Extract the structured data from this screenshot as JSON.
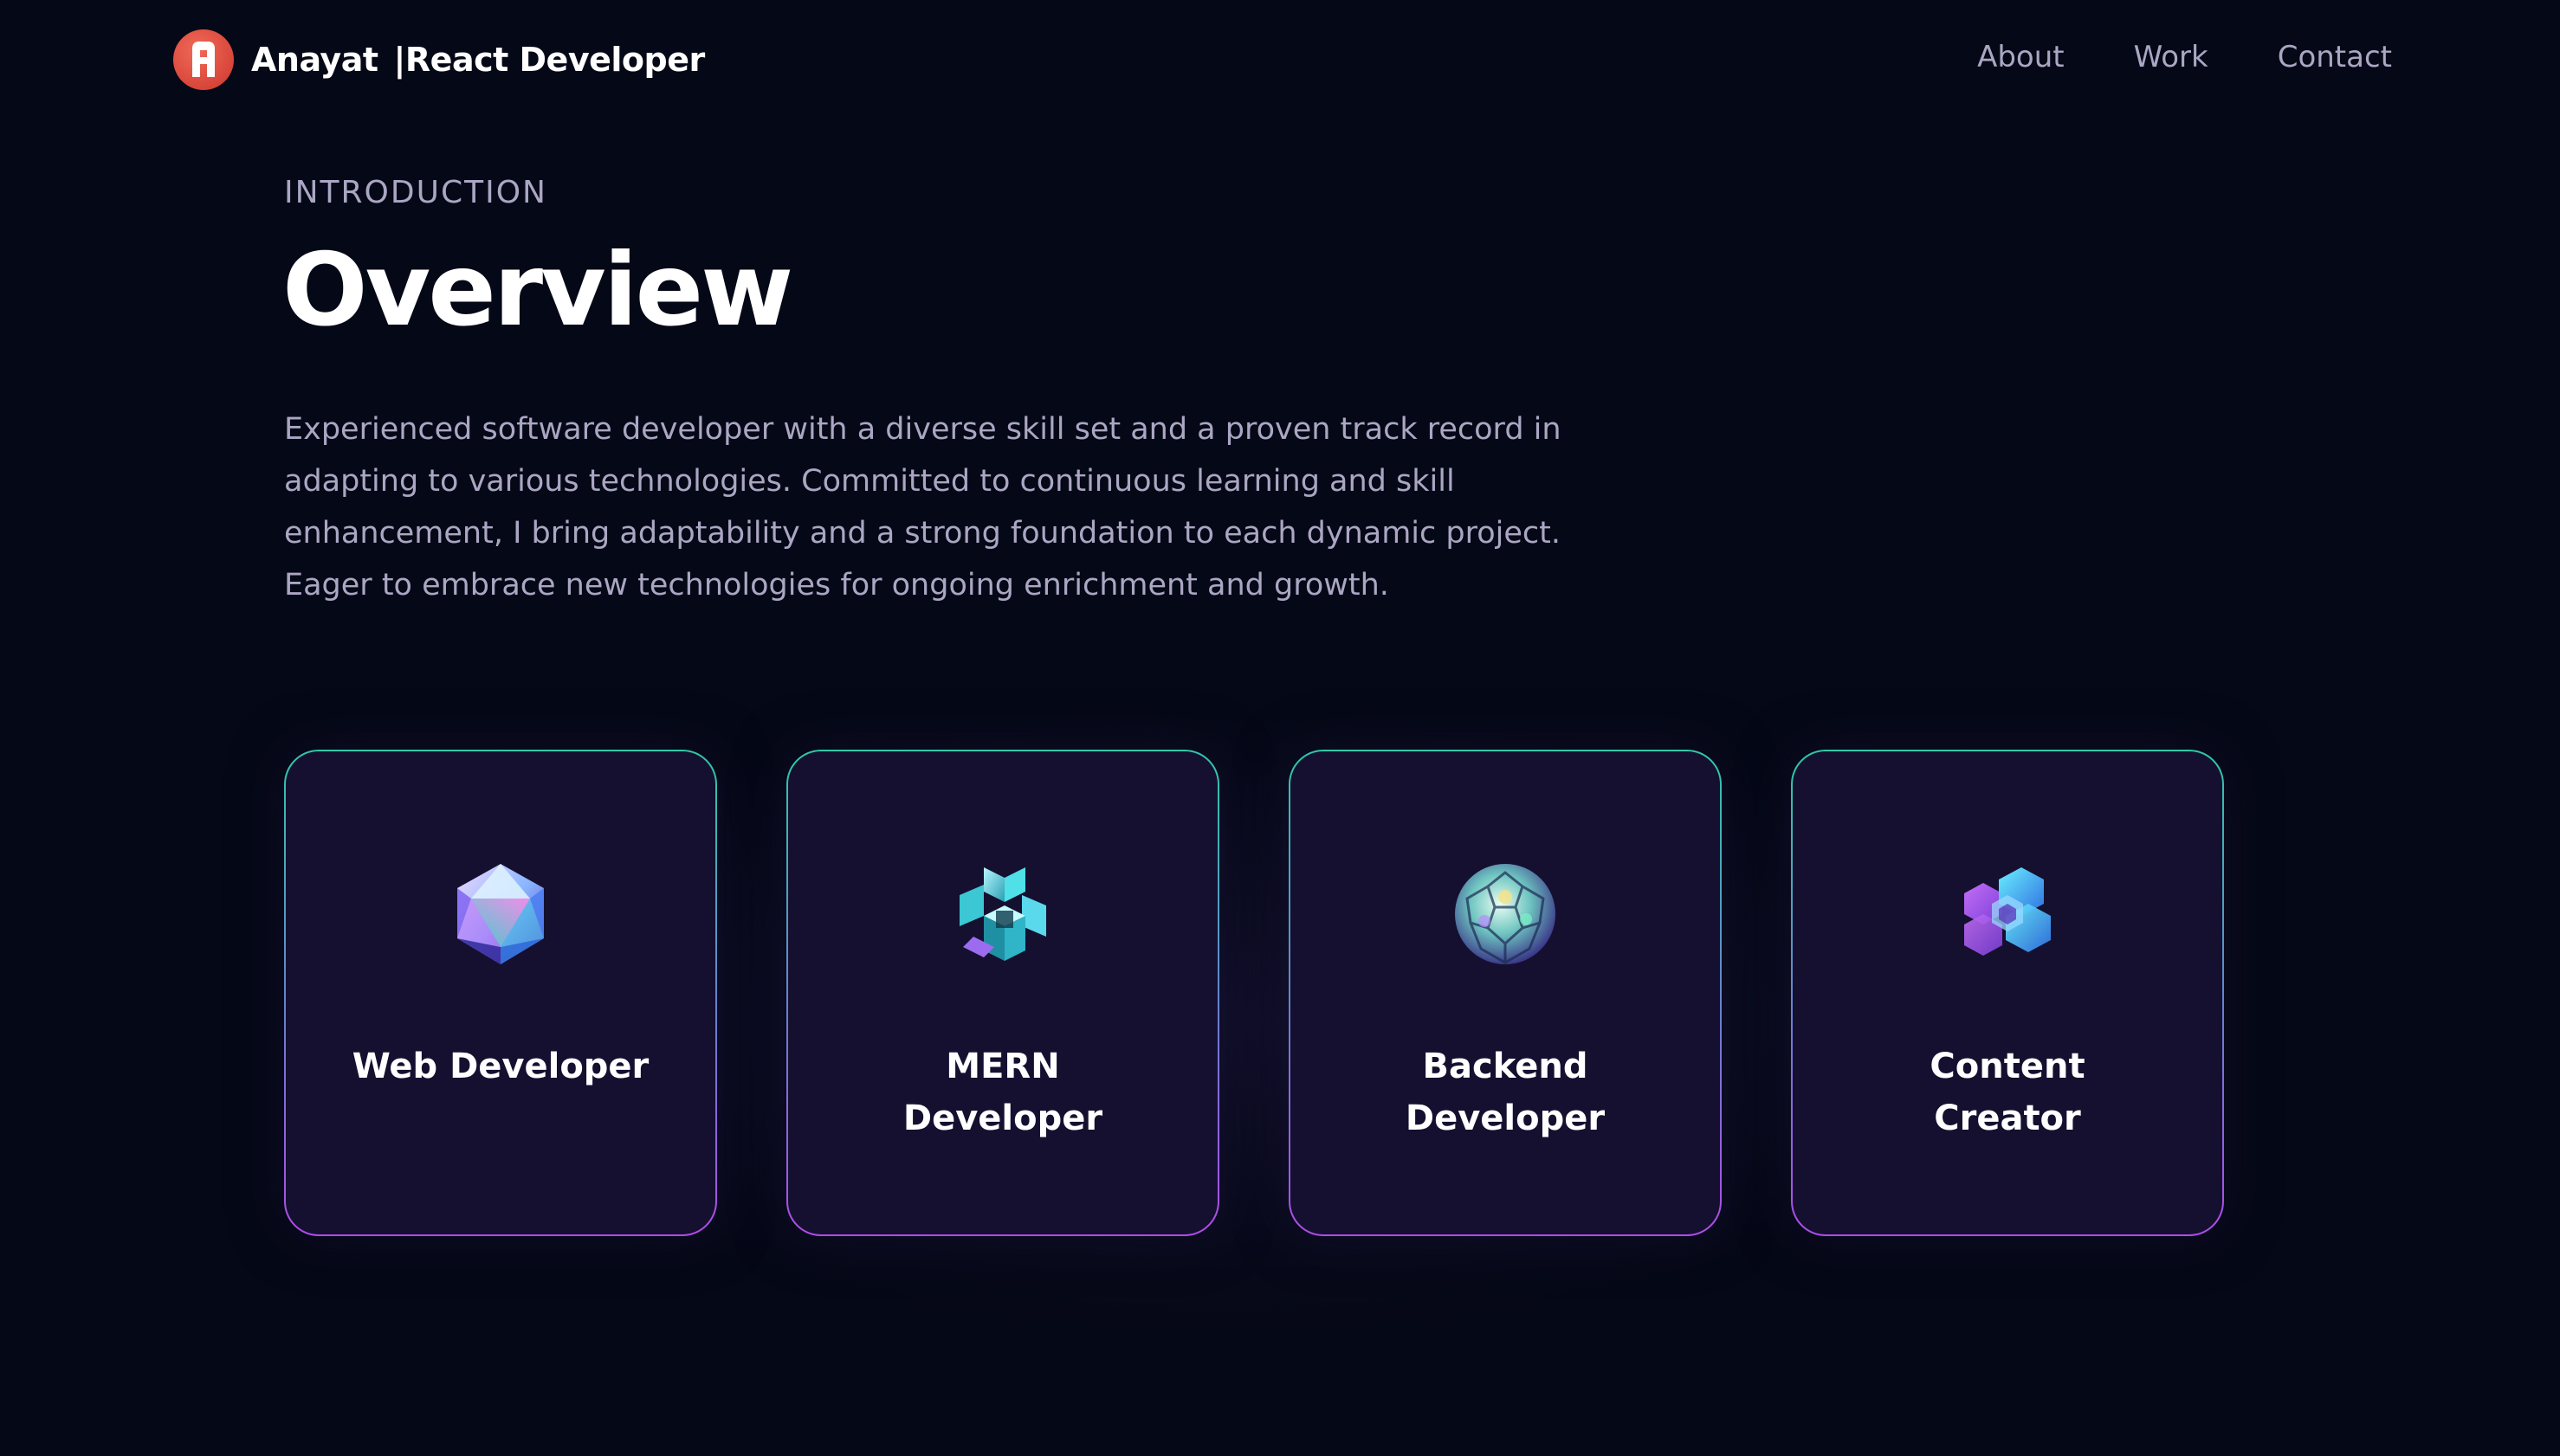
{
  "navbar": {
    "brand_name": "Anayat",
    "brand_divider": "|",
    "brand_role": "React Developer",
    "logo_icon": "letter-a-logo-icon",
    "links": [
      {
        "label": "About"
      },
      {
        "label": "Work"
      },
      {
        "label": "Contact"
      }
    ]
  },
  "intro": {
    "subtitle": "Introduction",
    "title": "Overview",
    "paragraph": "Experienced software developer with a diverse skill set and a proven track record in adapting to various technologies. Committed to continuous learning and skill enhancement, I bring adaptability and a strong foundation to each dynamic project. Eager to embrace new technologies for ongoing enrichment and growth."
  },
  "services": [
    {
      "title": "Web Developer",
      "icon": "icosahedron-icon"
    },
    {
      "title": "MERN Developer",
      "icon": "cube-knot-icon"
    },
    {
      "title": "Backend Developer",
      "icon": "crystal-sphere-icon"
    },
    {
      "title": "Content Creator",
      "icon": "hexagon-cluster-icon"
    }
  ],
  "colors": {
    "background": "#050816",
    "card_background": "#151030",
    "secondary_text": "#aaa6c3",
    "card_border_top": "#2fc9a9",
    "card_border_bottom": "#b04ce8",
    "logo_red": "#d8463a"
  }
}
